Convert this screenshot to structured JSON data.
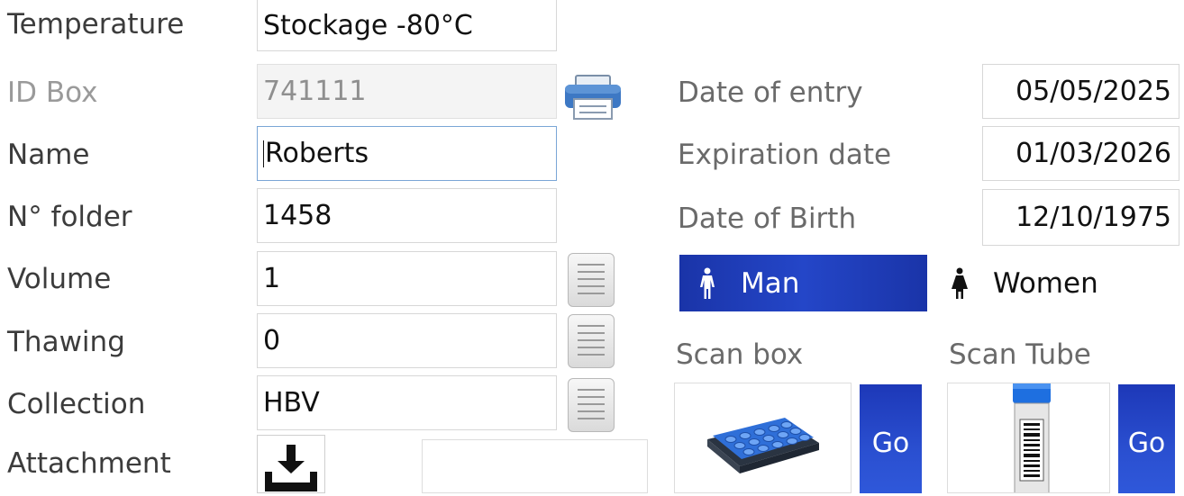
{
  "form": {
    "temperature": {
      "label": "Temperature",
      "value": "Stockage -80°C"
    },
    "id_box": {
      "label": "ID Box",
      "value": "741111"
    },
    "name": {
      "label": "Name",
      "value": "Roberts"
    },
    "folder": {
      "label": "N° folder",
      "value": "1458"
    },
    "volume": {
      "label": "Volume",
      "value": "1"
    },
    "thawing": {
      "label": "Thawing",
      "value": "0"
    },
    "collection": {
      "label": "Collection",
      "value": "HBV"
    },
    "attachment": {
      "label": "Attachment"
    }
  },
  "dates": {
    "entry": {
      "label": "Date of entry",
      "value": "05/05/2025"
    },
    "expiration": {
      "label": "Expiration date",
      "value": "01/03/2026"
    },
    "birth": {
      "label": "Date of Birth",
      "value": "12/10/1975"
    }
  },
  "sex": {
    "man_label": "Man",
    "women_label": "Women",
    "selected": "man"
  },
  "scan": {
    "box_label": "Scan box",
    "tube_label": "Scan Tube",
    "go_label": "Go"
  },
  "colors": {
    "accent": "#2446c8",
    "focus_border": "#7aa6d6"
  },
  "icons": {
    "print": "printer-icon",
    "notes": "notes-icon",
    "download": "download-icon",
    "man": "man-icon",
    "woman": "woman-icon"
  }
}
